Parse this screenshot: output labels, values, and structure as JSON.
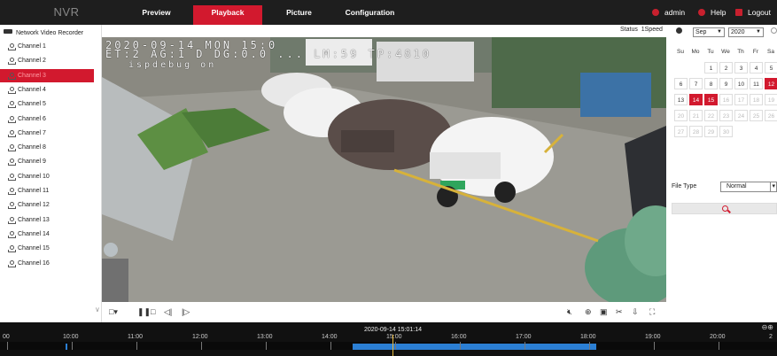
{
  "header": {
    "logo": "NVR",
    "tabs": [
      {
        "label": "Preview"
      },
      {
        "label": "Playback"
      },
      {
        "label": "Picture"
      },
      {
        "label": "Configuration"
      }
    ],
    "user": "admin",
    "help": "Help",
    "logout": "Logout"
  },
  "tree": {
    "root": "Network Video Recorder",
    "channels": [
      "Channel 1",
      "Channel 2",
      "Channel 3",
      "Channel 4",
      "Channel 5",
      "Channel 6",
      "Channel 7",
      "Channel 8",
      "Channel 9",
      "Channel 10",
      "Channel 11",
      "Channel 12",
      "Channel 13",
      "Channel 14",
      "Channel 15",
      "Channel 16"
    ],
    "selected": "Channel 3"
  },
  "player": {
    "status_label": "Status",
    "status_value": "1Speed",
    "osd_line1": "2020-09-14 MON 15:0",
    "osd_line2": "ET:2 AG:1 D DG:0.0 ... LM:59 TP:4810",
    "osd_line3": "ispdebug on"
  },
  "calendar": {
    "month": "Sep",
    "year": "2020",
    "weekdays": [
      "Su",
      "Mo",
      "Tu",
      "We",
      "Th",
      "Fr",
      "Sa"
    ],
    "rows": [
      [
        "",
        "",
        "1",
        "2",
        "3",
        "4",
        "5"
      ],
      [
        "6",
        "7",
        "8",
        "9",
        "10",
        "11",
        "12"
      ],
      [
        "13",
        "14",
        "15",
        "16",
        "17",
        "18",
        "19"
      ],
      [
        "20",
        "21",
        "22",
        "23",
        "24",
        "25",
        "26"
      ],
      [
        "27",
        "28",
        "29",
        "30",
        "",
        "",
        ""
      ]
    ],
    "recorded_days": [
      "12",
      "14",
      "15"
    ],
    "current_day": "14",
    "colors": {
      "accent": "#d2192e"
    }
  },
  "filter": {
    "file_type_label": "File Type",
    "file_type_value": "Normal"
  },
  "timeline": {
    "current": "2020-09-14 15:01:14",
    "hours": [
      "10:00",
      "11:00",
      "12:00",
      "13:00",
      "14:00",
      "15:00",
      "16:00",
      "17:00",
      "18:00",
      "19:00",
      "20:00"
    ],
    "edge_left": "00",
    "edge_right": "2"
  }
}
